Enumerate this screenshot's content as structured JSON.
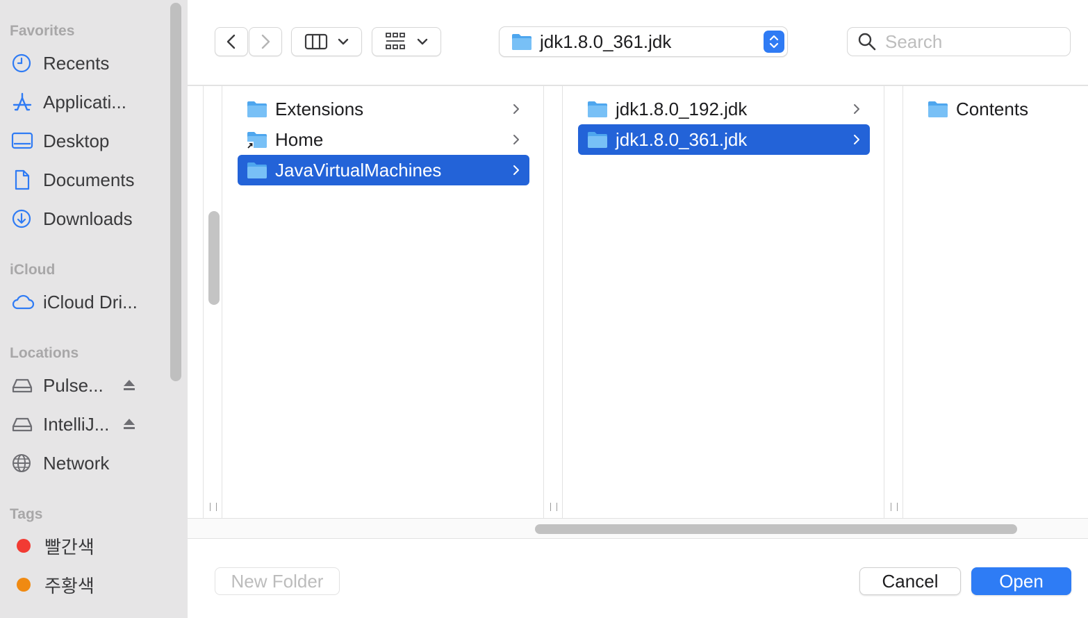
{
  "sidebar": {
    "favorites_header": "Favorites",
    "favorites": [
      {
        "label": "Recents",
        "icon": "clock-icon"
      },
      {
        "label": "Applicati...",
        "icon": "applications-icon"
      },
      {
        "label": "Desktop",
        "icon": "desktop-icon"
      },
      {
        "label": "Documents",
        "icon": "document-icon"
      },
      {
        "label": "Downloads",
        "icon": "download-icon"
      }
    ],
    "icloud_header": "iCloud",
    "icloud": [
      {
        "label": "iCloud Dri...",
        "icon": "cloud-icon"
      }
    ],
    "locations_header": "Locations",
    "locations": [
      {
        "label": "Pulse...",
        "icon": "drive-icon",
        "ejectable": true
      },
      {
        "label": "IntelliJ...",
        "icon": "drive-icon",
        "ejectable": true
      },
      {
        "label": "Network",
        "icon": "globe-icon"
      }
    ],
    "tags_header": "Tags",
    "tags": [
      {
        "label": "빨간색",
        "color": "#f23b33"
      },
      {
        "label": "주황색",
        "color": "#f08a12"
      }
    ],
    "accent_color": "#2f7bf4"
  },
  "toolbar": {
    "path_label": "jdk1.8.0_361.jdk",
    "search_placeholder": "Search"
  },
  "columns": [
    {
      "items": [
        {
          "label": "Extensions",
          "alias": false,
          "selected": false
        },
        {
          "label": "Home",
          "alias": true,
          "selected": false
        },
        {
          "label": "JavaVirtualMachines",
          "alias": false,
          "selected": true
        }
      ]
    },
    {
      "items": [
        {
          "label": "jdk1.8.0_192.jdk",
          "selected": false
        },
        {
          "label": "jdk1.8.0_361.jdk",
          "selected": true
        }
      ]
    },
    {
      "items": [
        {
          "label": "Contents",
          "selected": false
        }
      ]
    }
  ],
  "bottom": {
    "new_folder": "New Folder",
    "cancel": "Cancel",
    "open": "Open"
  },
  "colors": {
    "selection": "#2363d8",
    "primary_button": "#2e7cf5",
    "folder": "#6fb6f2"
  }
}
